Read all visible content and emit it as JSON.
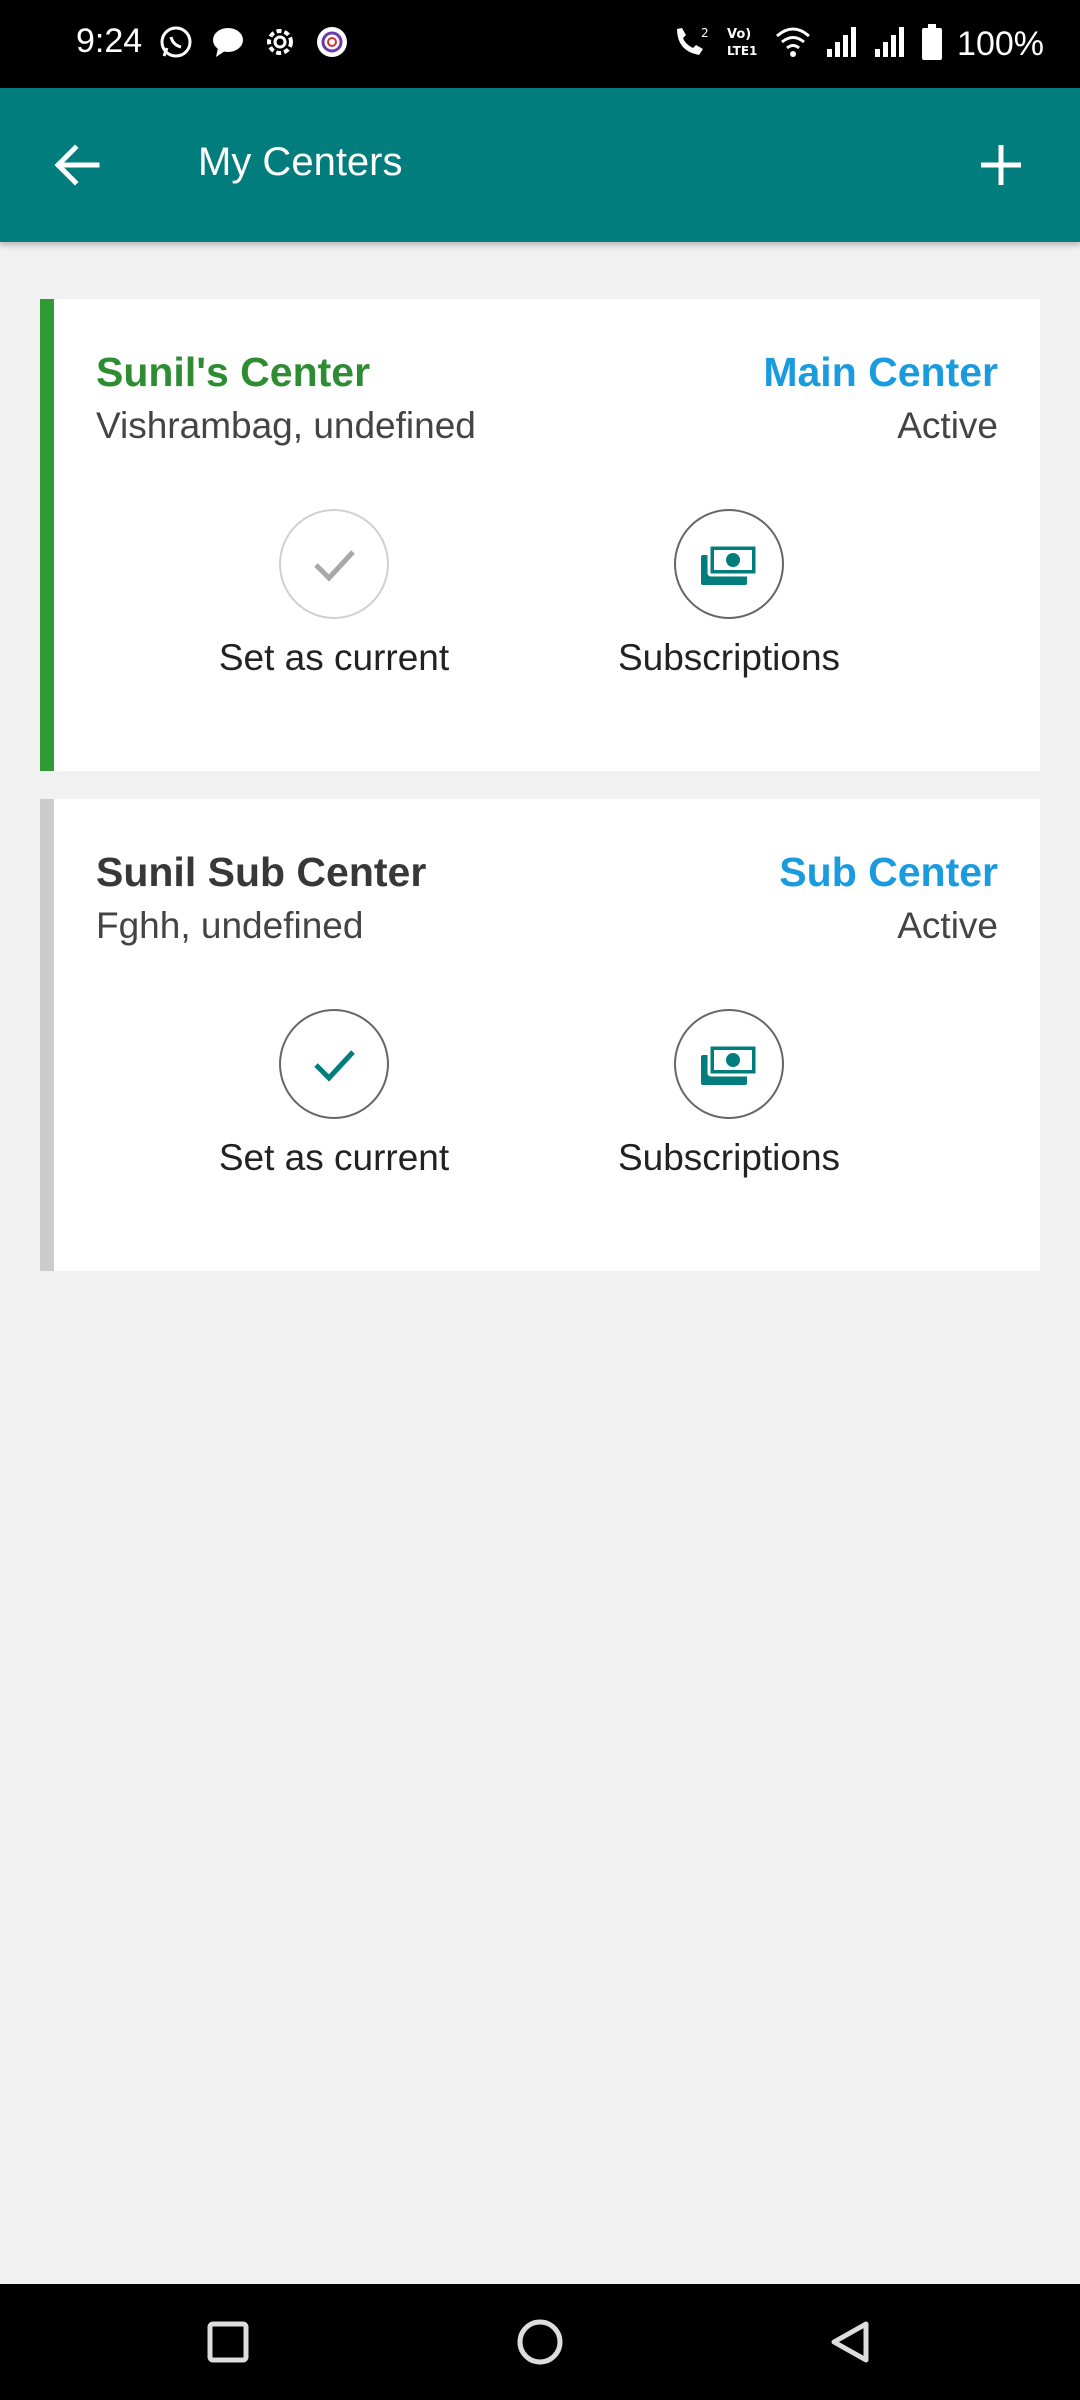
{
  "status_bar": {
    "time": "9:24",
    "left_icons": [
      "whatsapp-icon",
      "message-icon",
      "settings-icon",
      "app-icon"
    ],
    "right_icons": [
      "call-icon",
      "volte-icon",
      "wifi-icon",
      "signal-icon",
      "signal-icon",
      "battery-icon"
    ],
    "battery": "100%"
  },
  "app_bar": {
    "title": "My Centers",
    "back_icon": "arrow-back-icon",
    "add_icon": "plus-icon",
    "color": "#027d7d"
  },
  "centers": [
    {
      "name": "Sunil's Center",
      "address": "Vishrambag, undefined",
      "type": "Main Center",
      "status": "Active",
      "accent": "#2e9b34",
      "actions": {
        "set_current": "Set as current",
        "subscriptions": "Subscriptions"
      }
    },
    {
      "name": "Sunil Sub Center",
      "address": "Fghh, undefined",
      "type": "Sub Center",
      "status": "Active",
      "accent": "#cccccc",
      "actions": {
        "set_current": "Set as current",
        "subscriptions": "Subscriptions"
      }
    }
  ],
  "nav_bar": {
    "icons": [
      "recents-icon",
      "home-icon",
      "back-icon"
    ]
  }
}
